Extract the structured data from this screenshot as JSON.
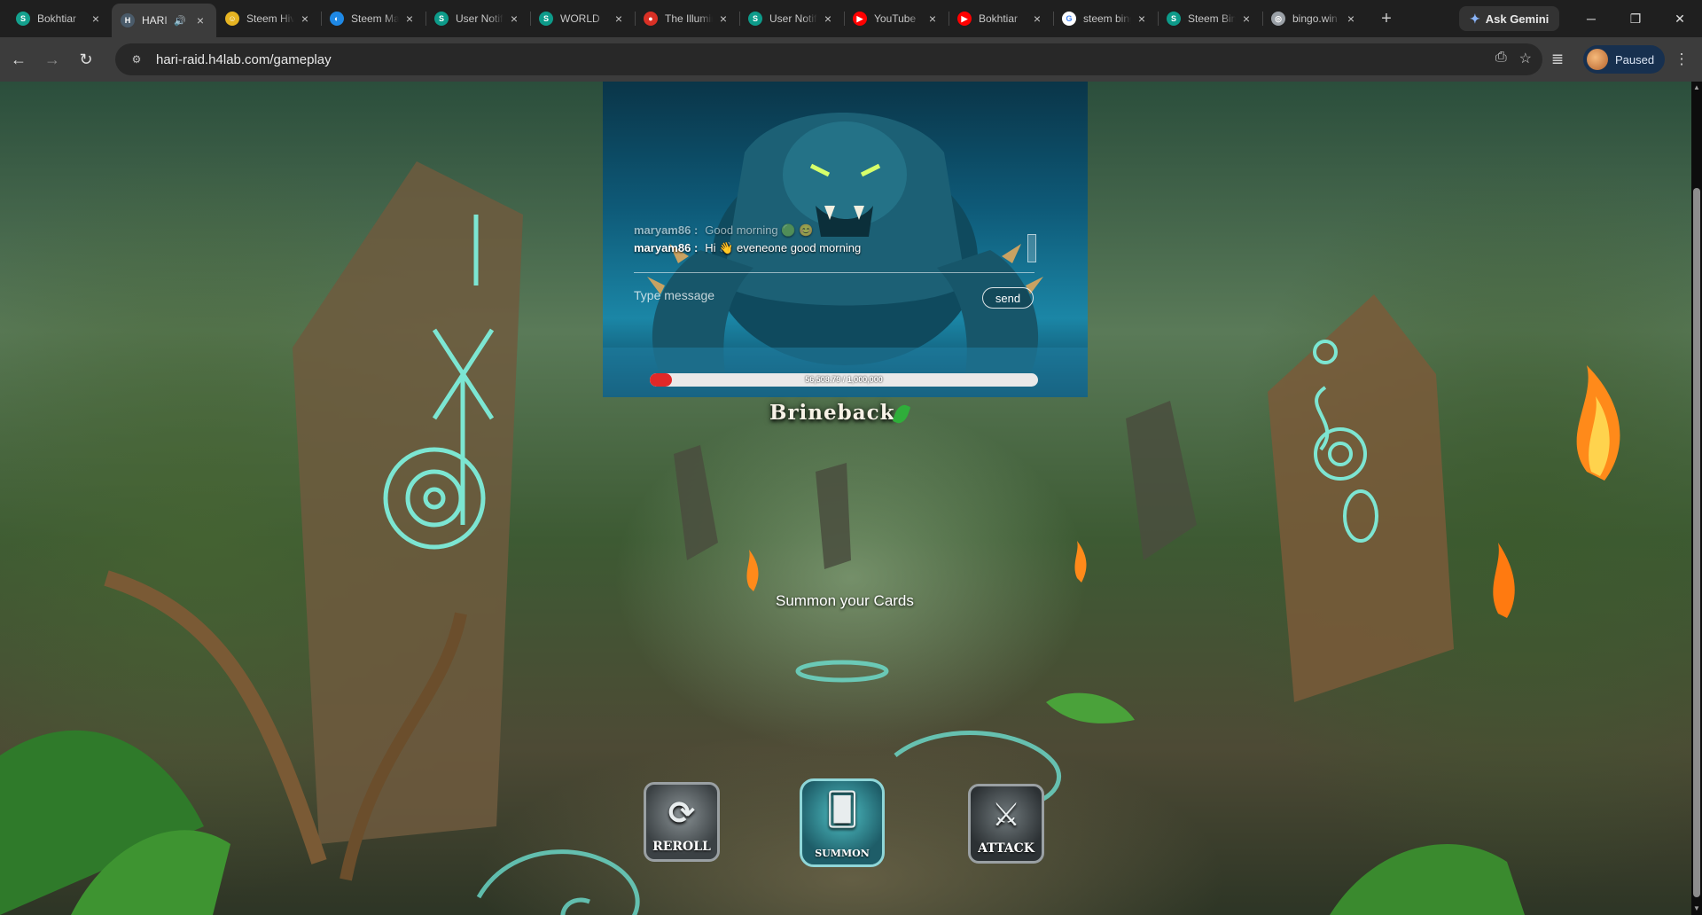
{
  "browser": {
    "tabs": [
      {
        "title": "Bokhtiar",
        "favicon_color": "#14a18e",
        "favicon_glyph": "S",
        "active": false
      },
      {
        "title": "HARI",
        "favicon_color": "#4a5b6a",
        "favicon_glyph": "H",
        "active": true,
        "audio": true
      },
      {
        "title": "Steem Hive",
        "favicon_color": "#e6b422",
        "favicon_glyph": "☺",
        "active": false
      },
      {
        "title": "Steem Mart",
        "favicon_color": "#1e88e5",
        "favicon_glyph": "◐",
        "active": false
      },
      {
        "title": "User Notifications",
        "favicon_color": "#0d9b8a",
        "favicon_glyph": "S",
        "active": false
      },
      {
        "title": "WORLD",
        "favicon_color": "#0d9b8a",
        "favicon_glyph": "S",
        "active": false
      },
      {
        "title": "The Illuminati",
        "favicon_color": "#d93025",
        "favicon_glyph": "●",
        "active": false
      },
      {
        "title": "User Notifications",
        "favicon_color": "#0d9b8a",
        "favicon_glyph": "S",
        "active": false
      },
      {
        "title": "YouTube",
        "favicon_color": "#ff0000",
        "favicon_glyph": "▶",
        "active": false
      },
      {
        "title": "Bokhtiar",
        "favicon_color": "#ff0000",
        "favicon_glyph": "▶",
        "active": false
      },
      {
        "title": "steem bingo",
        "favicon_color": "#ffffff",
        "favicon_glyph": "G",
        "active": false
      },
      {
        "title": "Steem Bingo",
        "favicon_color": "#0d9b8a",
        "favicon_glyph": "S",
        "active": false
      },
      {
        "title": "bingo.win",
        "favicon_color": "#9aa0a6",
        "favicon_glyph": "◎",
        "active": false
      }
    ],
    "new_tab_icon": "plus-icon",
    "ask_gemini": "Ask Gemini",
    "url": "hari-raid.h4lab.com/gameplay",
    "profile_status": "Paused"
  },
  "game": {
    "chat": {
      "messages": [
        {
          "user": "maryam86 :",
          "text": "Good morning 🟢 😊"
        },
        {
          "user": "maryam86 :",
          "text": "Hi 👋 eveneone good morning"
        }
      ],
      "input_placeholder": "Type message",
      "send_label": "send"
    },
    "boss": {
      "name": "Brineback",
      "hp_text": "56,508.79 / 1,000,000",
      "hp_fraction": 0.0565
    },
    "prompt": "Summon your Cards",
    "actions": {
      "reroll_label": "REROLL",
      "summon_label": "SUMMON",
      "attack_label": "ATTACK"
    }
  }
}
